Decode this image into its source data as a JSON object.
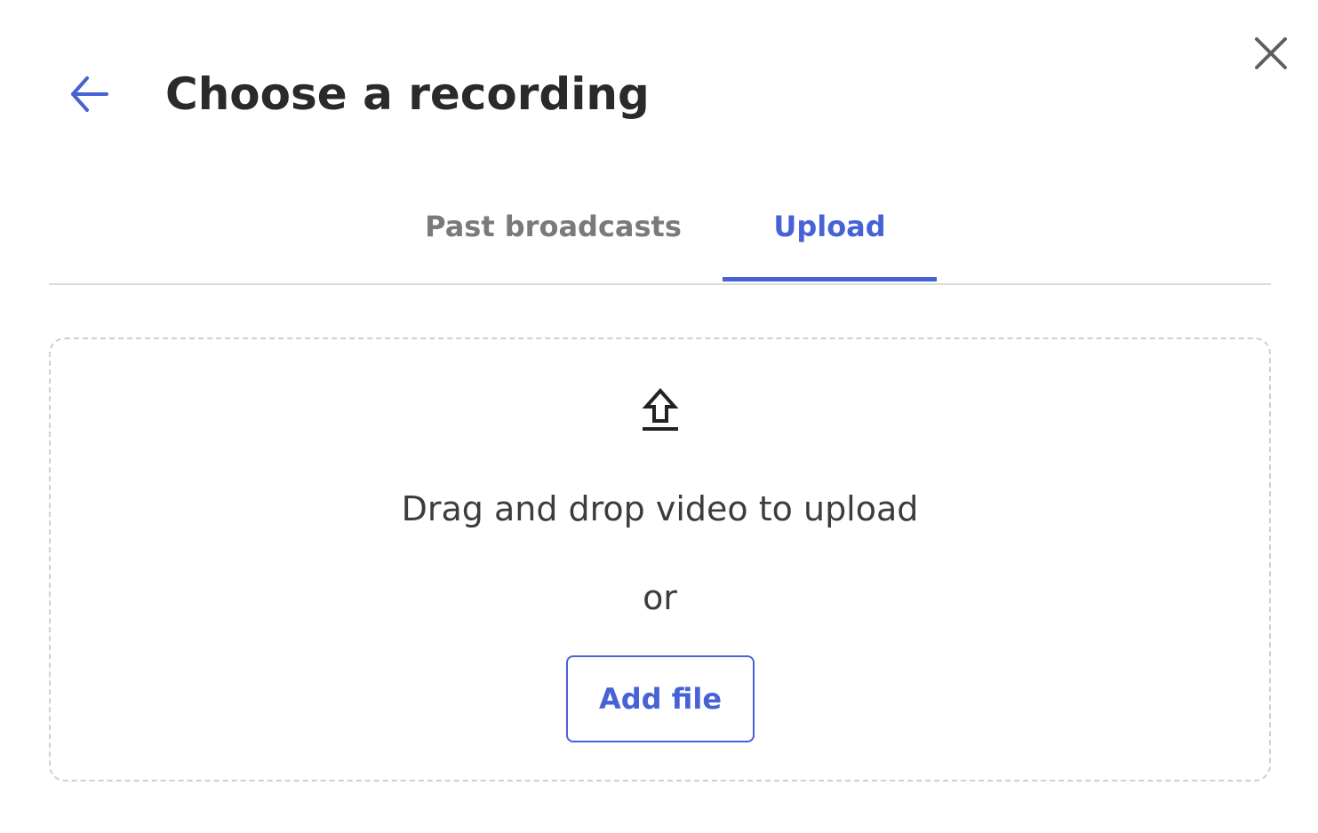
{
  "header": {
    "title": "Choose a recording",
    "back_icon": "arrow-left-icon",
    "close_icon": "close-icon"
  },
  "tabs": [
    {
      "label": "Past broadcasts",
      "active": false
    },
    {
      "label": "Upload",
      "active": true
    }
  ],
  "dropzone": {
    "icon": "upload-icon",
    "instruction": "Drag and drop video to upload",
    "separator": "or",
    "add_file_label": "Add file"
  },
  "colors": {
    "accent": "#4762d6",
    "title": "#2a2a2a",
    "body_text": "#3c3c3c",
    "inactive_tab": "#7a7a7a",
    "divider": "#dcdcdc",
    "dashed_border": "#cfcfcf"
  }
}
